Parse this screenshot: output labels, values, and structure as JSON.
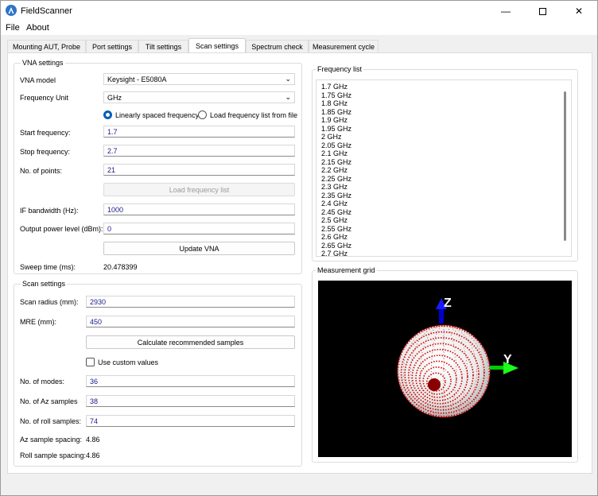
{
  "window": {
    "title": "FieldScanner"
  },
  "menu": [
    "File",
    "About"
  ],
  "tabs": [
    "Mounting AUT, Probe",
    "Port settings",
    "Tilt settings",
    "Scan settings",
    "Spectrum check",
    "Measurement cycle"
  ],
  "active_tab": "Scan settings",
  "vna": {
    "group_title": "VNA settings",
    "model_label": "VNA model",
    "model_value": "Keysight - E5080A",
    "unit_label": "Frequency Unit",
    "unit_value": "GHz",
    "radio_linear": "Linearly spaced frequency",
    "radio_file": "Load frequency list from file",
    "start_label": "Start frequency:",
    "start_value": "1.7",
    "stop_label": "Stop frequency:",
    "stop_value": "2.7",
    "points_label": "No. of points:",
    "points_value": "21",
    "load_button": "Load frequency list",
    "ifbw_label": "IF bandwidth (Hz):",
    "ifbw_value": "1000",
    "power_label": "Output power level (dBm):",
    "power_value": "0",
    "update_button": "Update VNA",
    "sweep_label": "Sweep time (ms):",
    "sweep_value": "20.478399"
  },
  "scan": {
    "group_title": "Scan settings",
    "radius_label": "Scan radius (mm):",
    "radius_value": "2930",
    "mre_label": "MRE (mm):",
    "mre_value": "450",
    "calc_button": "Calculate recommended samples",
    "custom_label": "Use custom values",
    "modes_label": "No. of modes:",
    "modes_value": "36",
    "az_label": "No. of Az samples",
    "az_value": "38",
    "roll_label": "No. of roll samples:",
    "roll_value": "74",
    "az_spacing_label": "Az sample spacing:",
    "az_spacing_value": "4.86",
    "roll_spacing_label": "Roll sample spacing:",
    "roll_spacing_value": "4.86"
  },
  "freq_list": {
    "title": "Frequency list",
    "items": [
      "1.7 GHz",
      "1.75 GHz",
      "1.8 GHz",
      "1.85 GHz",
      "1.9 GHz",
      "1.95 GHz",
      "2 GHz",
      "2.05 GHz",
      "2.1 GHz",
      "2.15 GHz",
      "2.2 GHz",
      "2.25 GHz",
      "2.3 GHz",
      "2.35 GHz",
      "2.4 GHz",
      "2.45 GHz",
      "2.5 GHz",
      "2.55 GHz",
      "2.6 GHz",
      "2.65 GHz",
      "2.7 GHz"
    ]
  },
  "grid": {
    "title": "Measurement grid",
    "axis_z": "Z",
    "axis_y": "Y"
  },
  "colors": {
    "accent": "#005fb8",
    "sphere": "#cc0000"
  }
}
